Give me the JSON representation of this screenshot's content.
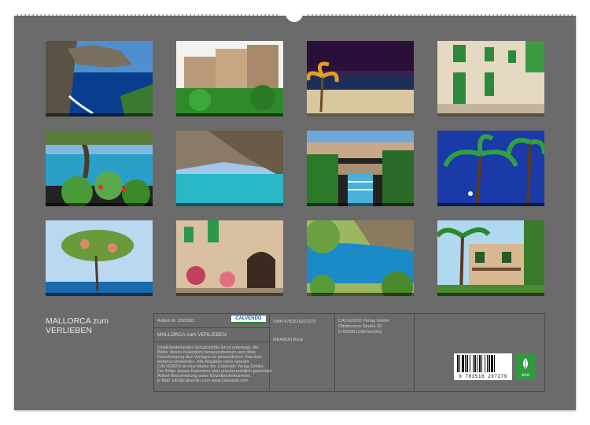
{
  "calendar": {
    "title_line1": "MALLORCA zum",
    "title_line2": "VERLIEBEN"
  },
  "photos": [
    {
      "scene": "coastal cliffs and sea"
    },
    {
      "scene": "stone village houses"
    },
    {
      "scene": "palm beach at night"
    },
    {
      "scene": "street with green shutters"
    },
    {
      "scene": "tree and cactus by the sea"
    },
    {
      "scene": "turquoise cove with rocks"
    },
    {
      "scene": "garden with fountain steps"
    },
    {
      "scene": "palm trees at night"
    },
    {
      "scene": "tree on the coast"
    },
    {
      "scene": "village doorway with flowers"
    },
    {
      "scene": "bay with green hills"
    },
    {
      "scene": "villa with palm trees"
    }
  ],
  "info": {
    "article_no": "Artikel-Nr. 2026383",
    "publisher_logo": "CALVENDO",
    "product_title": "MALLORCA zum VERLIEBEN",
    "description_lines": [
      "Inhalt bestehender Schutzrechte ist es untersagt, die",
      "Bilder dieses Kalenders herauszutrennen und ohne",
      "Genehmigung des Verlages zu gewerblichen Zwecken",
      "weiterzuverwenden. Alle Angaben ohne Gewähr.",
      "CALVENDO ist eine Marke der Calvendo Verlag GmbH.",
      "Die Bilder dieses Kalenders sind urheberrechtlich geschützt.",
      "Artikel-Beschreibung siehe Einzelbestellnummer.",
      "E-Mail: info@calvendo.com  www.calvendo.com"
    ],
    "isbn": "ISBN 9783516207279",
    "author": "MRABON Book",
    "publisher_name": "CALVENDO Verlag GmbH",
    "publisher_street": "Ottobrunner Straße 38",
    "publisher_city": "D-82008 Unterhaching",
    "barcode_digits": "9 783516 207279",
    "eco_label": "eco"
  }
}
